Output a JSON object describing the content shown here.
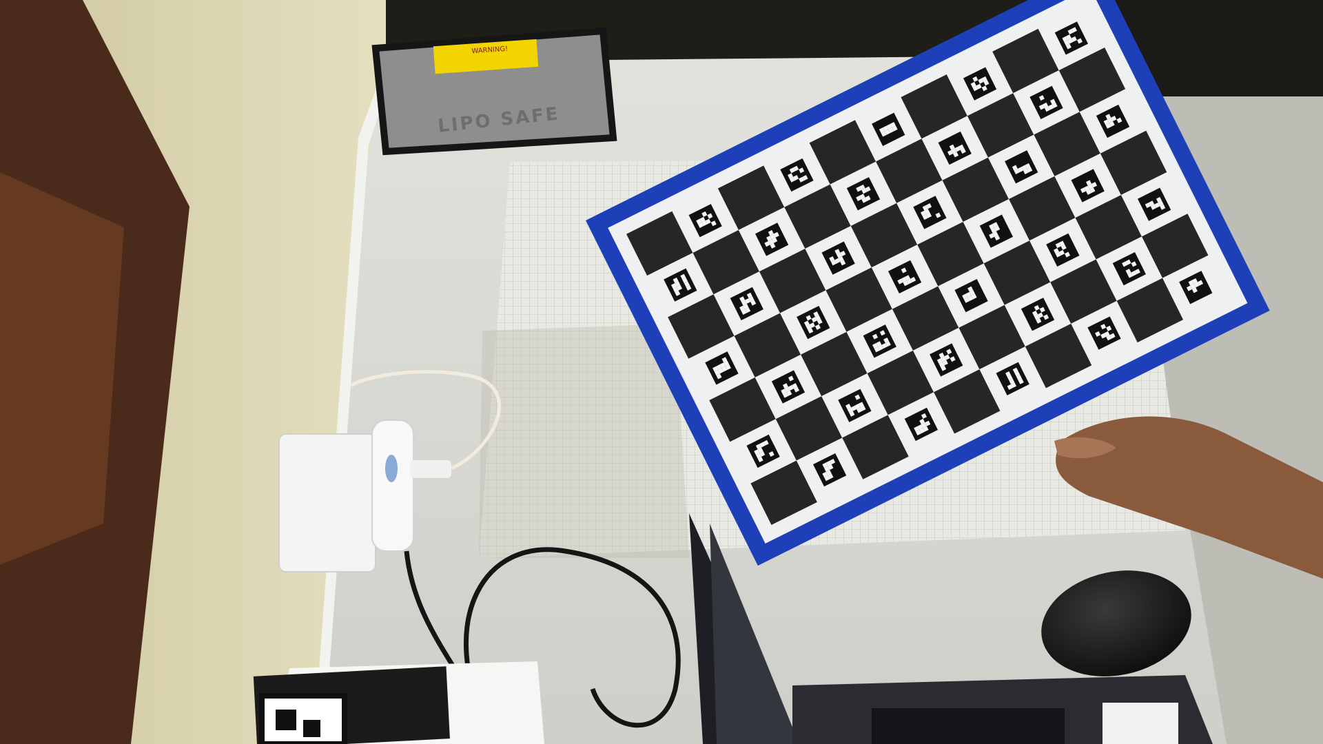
{
  "photo": {
    "lipo_bag": {
      "label": "LIPO SAFE",
      "warning_label": "WARNING!",
      "colors": {
        "bag": "#8e8e8e",
        "trim": "#161616",
        "sticker": "#f2d400"
      }
    },
    "charuco_board": {
      "rows": 7,
      "columns": 10,
      "colors": {
        "frame": "#1d3fb8",
        "dark_square": "#262626",
        "light_square": "#eef0f2"
      }
    },
    "wall_color": "#dcd6b0",
    "desk_color": "#d8d8d3",
    "grid_paper_color": "#e9e9e4",
    "mouse_color": "#151515",
    "laptop_color": "#2b2c31"
  }
}
